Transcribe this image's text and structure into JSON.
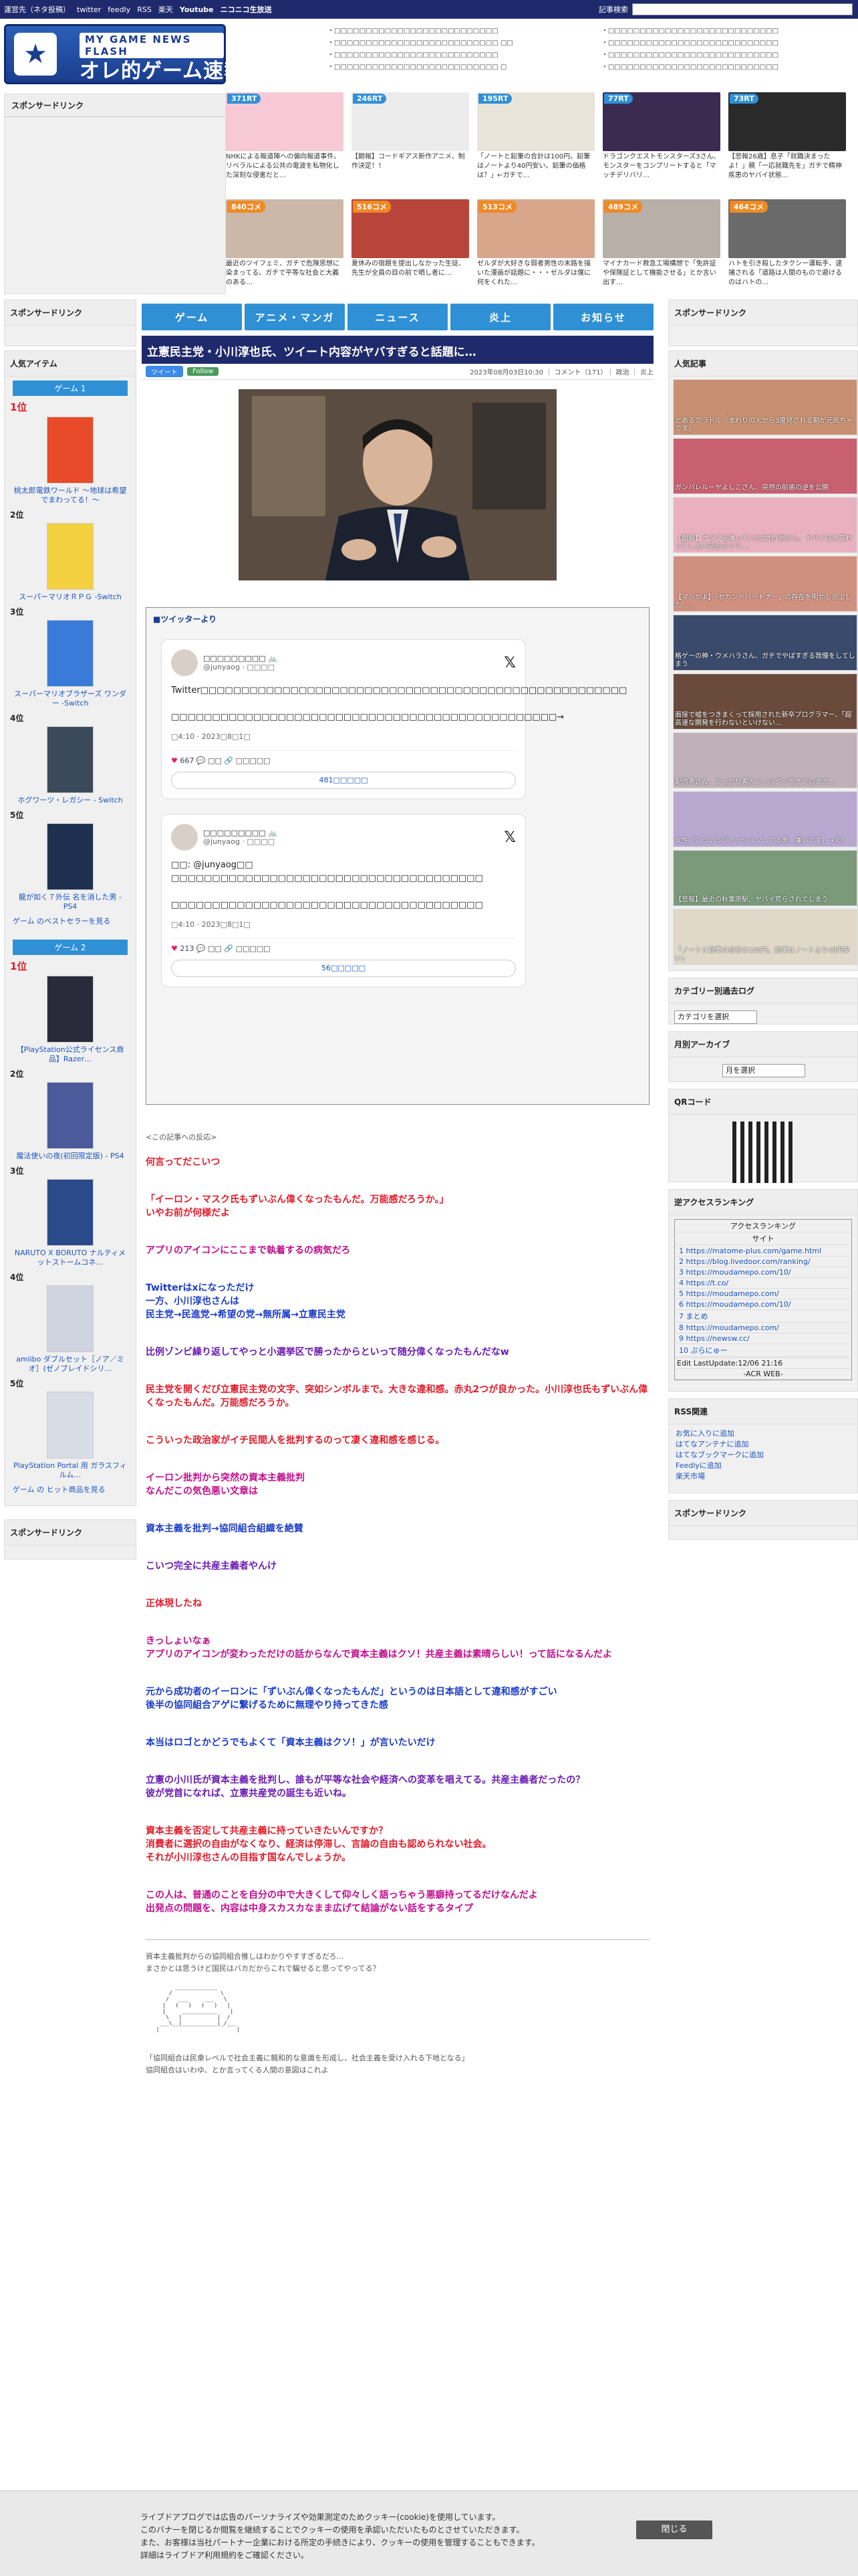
{
  "topbar": {
    "links": [
      "運営先（ネタ投稿）",
      "twitter",
      "feedly",
      "RSS",
      "楽天",
      "Youtube",
      "ニコニコ生放送"
    ],
    "search_label": "記事検索",
    "search_placeholder": ""
  },
  "logo": {
    "sub": "MY GAME NEWS FLASH",
    "main": "オレ的ゲーム速報@JIN"
  },
  "header_links_a": [
    "・□□□□□□□□□□□□□□□□□□□□□□□□□□",
    "・□□□□□□□□□□□□□□□□□□□□□□□□□□ □□",
    "・□□□□□□□□□□□□□□□□□□□□□□□□□□",
    "・□□□□□□□□□□□□□□□□□□□□□□□□□□ □"
  ],
  "header_links_b": [
    "・□□□□□□□□□□□□□□□□□□□□□□□□□□□",
    "・□□□□□□□□□□□□□□□□□□□□□□□□□□□",
    "・□□□□□□□□□□□□□□□□□□□□□□□□□□□",
    "・□□□□□□□□□□□□□□□□□□□□□□□□□□□"
  ],
  "left_sponsor": "スポンサードリンク",
  "tiles": [
    {
      "badge": "371RT",
      "color": "#2f90d6",
      "bg": "#f7c8d6",
      "text": "NHKによる報道陣への偏向報道事件。リベラルによる公共の電波を私物化した深刻な侵害だと…"
    },
    {
      "badge": "246RT",
      "color": "#2f90d6",
      "bg": "#ececec",
      "text": "【朗報】コードギアス新作アニメ、制作決定！！"
    },
    {
      "badge": "195RT",
      "color": "#2f90d6",
      "bg": "#e9e4da",
      "text": "「ノートと鉛筆の合計は100円。鉛筆はノートより40円安い。鉛筆の価格は？」←ガチで…"
    },
    {
      "badge": "77RT",
      "color": "#2f90d6",
      "bg": "#3b2a52",
      "text": "ドラゴンクエストモンスターズ3さん、モンスターをコンプリートすると「マッチデリバリ…"
    },
    {
      "badge": "73RT",
      "color": "#2f90d6",
      "bg": "#2a2a2a",
      "text": "【悲報26歳】息子「就職決まったよ！」親「一応就職先を」ガチで精神疾患のヤバイ状態…"
    },
    {
      "badge": "840コメ",
      "color": "#f08a24",
      "bg": "#cbb8a8",
      "text": "最近のツイフェミ、ガチで危険思想に染まってる。ガチで平等な社会と大義のある…"
    },
    {
      "badge": "516コメ",
      "color": "#f08a24",
      "bg": "#b8453a",
      "text": "夏休みの宿題を提出しなかった生徒、先生が全員の目の前で晒し者に…"
    },
    {
      "badge": "513コメ",
      "color": "#f08a24",
      "bg": "#d8a68a",
      "text": "ゼルダが大好きな弱者男性の末路を描いた漫画が話題に・・・ゼルダは僕に何をくれた…"
    },
    {
      "badge": "489コメ",
      "color": "#f08a24",
      "bg": "#b8b0a8",
      "text": "マイナカード救急工場構想で「免許証や保険証として機能させる」とか言い出す…"
    },
    {
      "badge": "464コメ",
      "color": "#f08a24",
      "bg": "#6a6a6a",
      "text": "ハトを引き殺したタクシー運転手、逮捕される「道路は人間のもので避けるのはハトの…"
    }
  ],
  "nav": [
    "ゲーム",
    "アニメ・マンガ",
    "ニュース",
    "炎上",
    "お知らせ"
  ],
  "article": {
    "title": "立憲民主党・小川淳也氏、ツイート内容がヤバすぎると話題に…",
    "share_tw": "ツイート",
    "share_fb": "Follow",
    "info": "2023年08月03日10:30 ｜ コメント（171）｜ 政治 ｜ 炎上",
    "twitter_head": "■ツイッターより",
    "tweets": [
      {
        "name": "□□□□□□□□□ 🚲",
        "handle": "@junyaog · □□□□",
        "body": "Twitter□□□□□□□□□□□□□□□□□□□□□□□□□□□□□□□□□□□□□□□□□□□□□□□□□□□□\n\n□□□□□□□□□□□□□□□□□□□□□□□□□□□□□□□□□□□□□□□□□□□□□□□→",
        "time": "□4:10 · 2023□8□1□",
        "likes": "667",
        "reply": "□□",
        "link": "□□□□□",
        "more": "481□□□□□"
      },
      {
        "name": "□□□□□□□□□ 🚲",
        "handle": "@junyaog · □□□□",
        "body": "□□: @junyaog□□\n□□□□□□□□□□□□□□□□□□□□□□□□□□□□□□□□□□□□□□\n\n□□□□□□□□□□□□□□□□□□□□□□□□□□□□□□□□□□□□□□",
        "time": "□4:10 · 2023□8□1□",
        "likes": "213",
        "reply": "□□",
        "link": "□□□□□",
        "more": "56□□□□□"
      }
    ],
    "reactions_lead": "<この記事への反応>",
    "comments": [
      {
        "c": "red",
        "t": "何言ってだこいつ"
      },
      {
        "c": "red",
        "t": "「イーロン・マスク氏もずいぶん偉くなったもんだ。万能感だろうか。」\nいやお前が何様だよ"
      },
      {
        "c": "mag",
        "t": "アプリのアイコンにここまで執着するの病気だろ"
      },
      {
        "c": "blu",
        "t": "Twitterはxになっただけ\n一方、小川淳也さんは\n民主党→民進党→希望の党→無所属→立憲民主党"
      },
      {
        "c": "pur",
        "t": "比例ゾンビ繰り返してやっと小選挙区で勝ったからといって随分偉くなったもんだなw"
      },
      {
        "c": "red",
        "t": "民主党を開くだび立憲民主党の文字、突如シンボルまで。大きな違和感。赤丸2つが良かった。小川淳也氏もずいぶん偉くなったもんだ。万能感だろうか。"
      },
      {
        "c": "red",
        "t": "こういった政治家がイチ民間人を批判するのって凄く違和感を感じる。"
      },
      {
        "c": "mag",
        "t": "イーロン批判から突然の資本主義批判\nなんだこの気色悪い文章は"
      },
      {
        "c": "blu",
        "t": "資本主義を批判→協同組合組織を絶賛"
      },
      {
        "c": "pur",
        "t": "こいつ完全に共産主義者やんけ"
      },
      {
        "c": "red",
        "t": "正体現したね"
      },
      {
        "c": "mag",
        "t": "きっしょいなぁ\nアプリのアイコンが変わっただけの話からなんで資本主義はクソ！共産主義は素晴らしい！って話になるんだよ"
      },
      {
        "c": "blu",
        "t": "元から成功者のイーロンに「ずいぶん偉くなったもんだ」というのは日本語として違和感がすごい\n後半の協同組合アゲに繋げるために無理やり持ってきた感"
      },
      {
        "c": "blu",
        "t": "本当はロゴとかどうでもよくて「資本主義はクソ！」が言いたいだけ"
      },
      {
        "c": "pur",
        "t": "立憲の小川氏が資本主義を批判し、誰もが平等な社会や経済への変革を唱えてる。共産主義者だったの？\n彼が党首になれば、立憲共産党の誕生も近いね。"
      },
      {
        "c": "red",
        "t": "資本主義を否定して共産主義に持っていきたいんですか？\n消費者に選択の自由がなくなり、経済は停滞し、言論の自由も認められない社会。\nそれが小川淳也さんの目指す国なんでしょうか。"
      },
      {
        "c": "mag",
        "t": "この人は、普通のことを自分の中で大きくして仰々しく語っちゃう悪癖持ってるだけなんだよ\n出発点の問題を、内容は中身スカスカなまま広げて結論がない話をするタイプ"
      }
    ],
    "footer_text_1": "資本主義批判からの協同組合推しはわかりやすすぎるだろ…",
    "footer_text_2": "まさかとは思うけど国民はバカだからこれで騙せると思ってやってる？",
    "aa": "        _____________\n      /               \\\n     /   ___     ___   \\\n    |   (   )   (   )   |\n    |     ___________    |\n     \\   |           |  /\n   ___\\__|___________|_/___\n  |                        |",
    "quote": "「協同組合は民衆レベルで社会主義に親和的な意識を形成し、社会主義を受け入れる下地となる」",
    "quote2": "協同組合はいわゆ、とか言ってくる人間の意図はこれよ"
  },
  "left_col": {
    "sponsor": "スポンサードリンク",
    "popular": "人気アイテム",
    "game1": "ゲーム 1",
    "game2": "ゲーム 2",
    "items1": [
      {
        "rank": "1位",
        "name": "桃太郎電鉄ワールド ～地球は希望でまわってる！～",
        "bg": "#e84a2a"
      },
      {
        "rank": "2位",
        "name": "スーパーマリオＲＰＧ -Switch",
        "bg": "#f2d040"
      },
      {
        "rank": "3位",
        "name": "スーパーマリオブラザーズ ワンダー -Switch",
        "bg": "#3a7ad8"
      },
      {
        "rank": "4位",
        "name": "ホグワーツ・レガシー - Switch",
        "bg": "#3a4a5a"
      },
      {
        "rank": "5位",
        "name": "龍が如く７外伝 名を消した男 - PS4",
        "bg": "#1e3050"
      }
    ],
    "more1": "ゲーム のベストセラーを見る",
    "items2": [
      {
        "rank": "1位",
        "name": "【PlayStation公式ライセンス商品】Razer…",
        "bg": "#2a2a3a"
      },
      {
        "rank": "2位",
        "name": "魔法使いの夜(初回限定版) - PS4",
        "bg": "#4a5a9a"
      },
      {
        "rank": "3位",
        "name": "NARUTO X BORUTO ナルティメットストームコネ…",
        "bg": "#2a4a8a"
      },
      {
        "rank": "4位",
        "name": "amiibo ダブルセット［ノア／ミオ］(ゼノブレイドシリ…",
        "bg": "#d0d4e0"
      },
      {
        "rank": "5位",
        "name": "PlayStation Portal 用 ガラスフィルム…",
        "bg": "#d8dce4"
      }
    ],
    "more2": "ゲーム の ヒット商品を見る",
    "sponsor2": "スポンサードリンク"
  },
  "right_col": {
    "sponsor": "スポンサードリンク",
    "popular": "人気記事",
    "pops": [
      {
        "t": "とあるグラドル「まわりの人から3度見される期が元気ちゃです」",
        "bg": "#c89070"
      },
      {
        "t": "ガンバレルーヤよしこさん、突然の前歯の逆を公開",
        "bg": "#c86070"
      },
      {
        "t": "【朗報】オタクを嫌っていた女性Y民さん、ヤバイほど変わってしまい新生ネッツ…",
        "bg": "#e8b0c0"
      },
      {
        "t": "【マジかよ】「セカンドパートナー」の存在を明かし炎上した……",
        "bg": "#d09080"
      },
      {
        "t": "格ゲーの神・ウメハラさん、ガチでやばすぎる我慢をしてしまう",
        "bg": "#3a4a6a"
      },
      {
        "t": "面接で嘘をつきまくって採用された新卒プログラマー、「超高速な開発を行わないといけない…",
        "bg": "#6a4a3a"
      },
      {
        "t": "配信者さん、うっかり素人フィルターをオフのまま…",
        "bg": "#c0b0b8"
      },
      {
        "t": "女性「こういうファッションしてる男、嫌いです」→え？",
        "bg": "#b8a8d0"
      },
      {
        "t": "【悲報】最近の秋葉原駅、ヤバイ荒らされてしまう",
        "bg": "#7a9a7a"
      },
      {
        "t": "「ノートと鉛筆の合計は100円。鉛筆はノートより40円安い」",
        "bg": "#e0d8c8"
      }
    ],
    "cat_head": "カテゴリー別過去ログ",
    "cat_sel": "カテゴリを選択",
    "month_head": "月別アーカイブ",
    "month_sel": "月を選択",
    "qr_head": "QRコード",
    "rank_head": "逆アクセスランキング",
    "rank_title": "アクセスランキング",
    "rank_site": "サイト",
    "rank_rows": [
      "1 https://matome-plus.com/game.html",
      "2 https://blog.livedoor.com/ranking/",
      "3 https://moudamepo.com/10/",
      "4 https://t.co/",
      "5 https://moudamepo.com/",
      "6 https://moudamepo.com/10/",
      "7 まとめ",
      "8 https://moudamepo.com/",
      "9 https://newsw.cc/",
      "10 ぷらにゅー"
    ],
    "rank_updated": "Edit LastUpdate:12/06 21:16",
    "rank_brand": "-ACR WEB-",
    "rss_head": "RSS関連",
    "rss_links": [
      "お気に入りに追加",
      "はてなアンテナに追加",
      "はてなブックマークに追加",
      "Feedlyに追加",
      "楽天市場"
    ],
    "sponsor2": "スポンサードリンク"
  },
  "cookie": {
    "text": "ライブドアブログでは広告のパーソナライズや効果測定のためクッキー(cookie)を使用しています。\nこのバナーを閉じるか閲覧を継続することでクッキーの使用を承認いただいたものとさせていただきます。\nまた、お客様は当社パートナー企業における所定の手続きにより、クッキーの使用を管理することもできます。\n詳細はライブドア利用規約をご確認ください。",
    "button": "閉じる"
  }
}
